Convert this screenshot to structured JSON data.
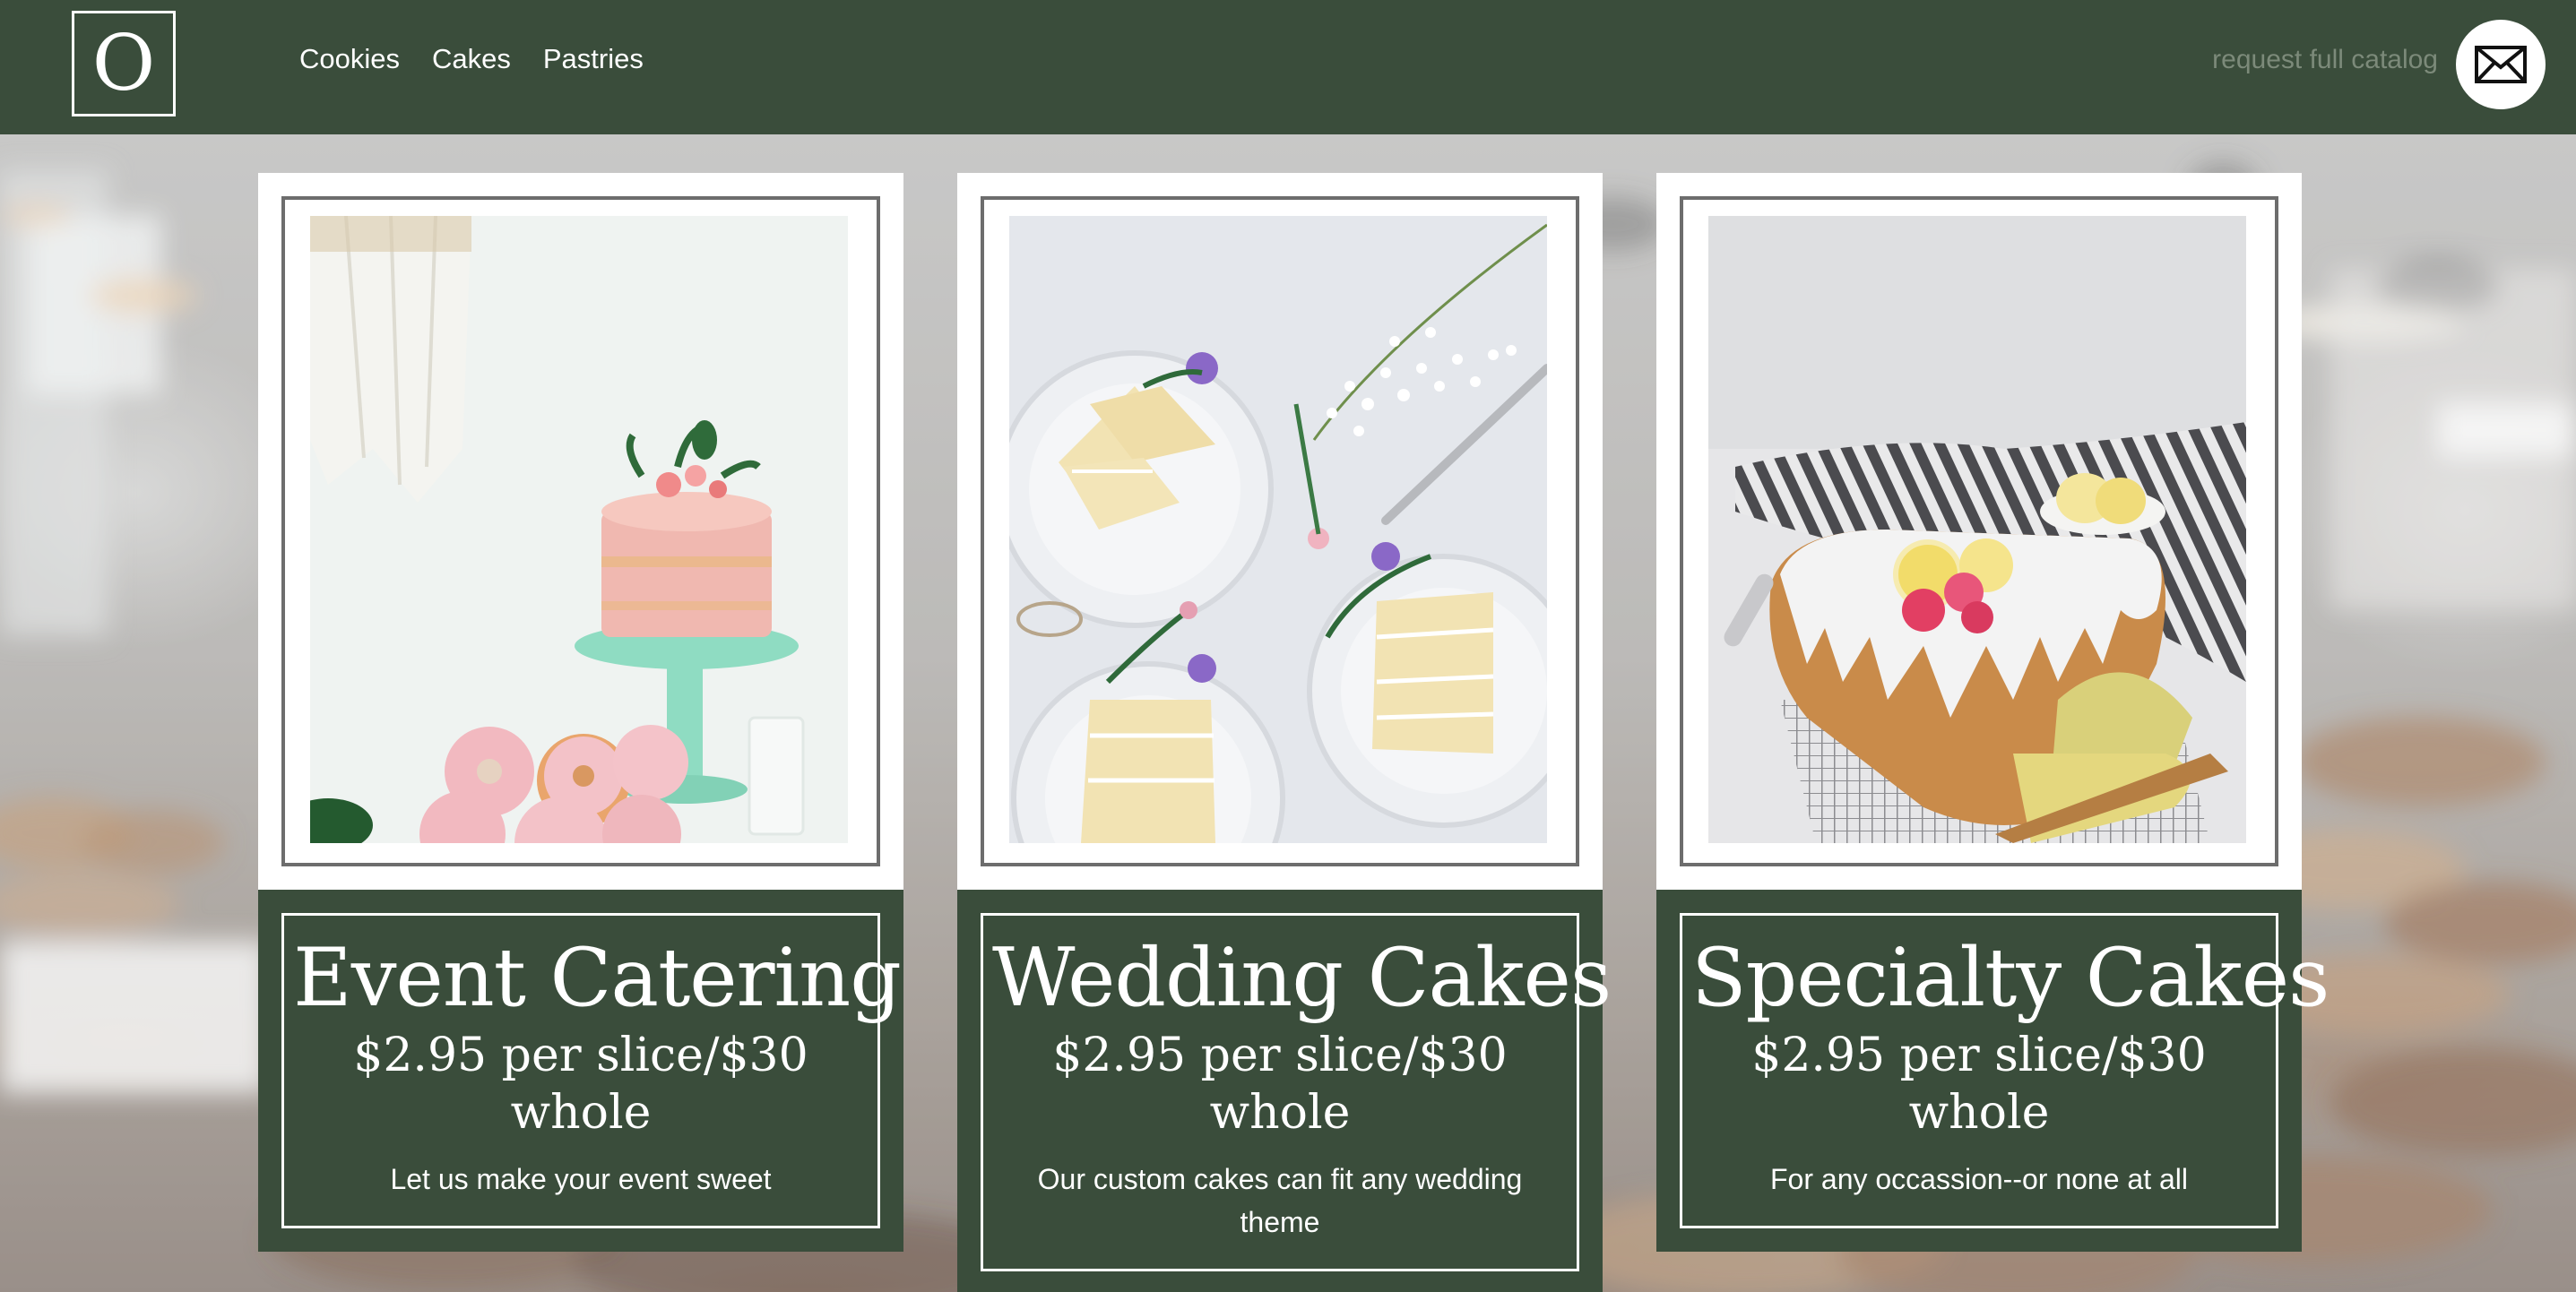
{
  "header": {
    "logo_letter": "O",
    "nav": [
      {
        "label": "Cookies"
      },
      {
        "label": "Cakes"
      },
      {
        "label": "Pastries"
      }
    ],
    "catalog_link": "request full catalog",
    "mail_icon": "envelope-icon"
  },
  "cards": [
    {
      "title": "Event Catering",
      "price": "$2.95 per slice/$30 whole",
      "description": "Let us make your event sweet",
      "photo": "pink-naked-cake-on-mint-stand-with-donuts"
    },
    {
      "title": "Wedding Cakes",
      "price": "$2.95 per slice/$30 whole",
      "description": "Our custom cakes can fit any wedding theme",
      "photo": "cake-slices-on-white-plates-with-flowers"
    },
    {
      "title": "Specialty Cakes",
      "price": "$2.95 per slice/$30 whole",
      "description": "For any occassion--or none at all",
      "photo": "glazed-lemon-loaf-cake-on-cooling-rack"
    }
  ],
  "colors": {
    "brand_green": "#3a4d3b",
    "catalog_link": "#7c8a7a",
    "frame_gray": "#6d6d6d"
  }
}
